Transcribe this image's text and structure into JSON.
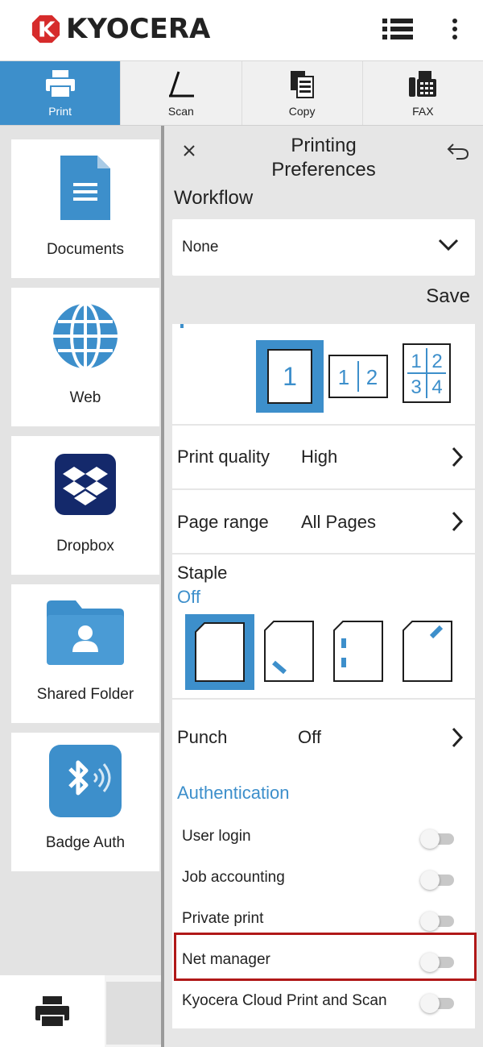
{
  "header": {
    "brand": "KYOCERA",
    "brand_color": "#d62b2b"
  },
  "tabs": [
    {
      "label": "Print",
      "icon": "printer-icon",
      "active": true
    },
    {
      "label": "Scan",
      "icon": "scan-icon",
      "active": false
    },
    {
      "label": "Copy",
      "icon": "copy-icon",
      "active": false
    },
    {
      "label": "FAX",
      "icon": "fax-icon",
      "active": false
    }
  ],
  "sidebar": {
    "items": [
      {
        "label": "Documents",
        "icon": "document-icon"
      },
      {
        "label": "Web",
        "icon": "globe-icon"
      },
      {
        "label": "Dropbox",
        "icon": "dropbox-icon"
      },
      {
        "label": "Shared Folder",
        "icon": "shared-folder-icon"
      },
      {
        "label": "Badge Auth",
        "icon": "badge-bluetooth-icon"
      }
    ]
  },
  "panel": {
    "title_line1": "Printing",
    "title_line2": "Preferences",
    "workflow_label": "Workflow",
    "workflow_value": "None",
    "save_label": "Save",
    "layout_options": [
      "1",
      "1 2",
      "1 2 3 4"
    ],
    "print_quality_label": "Print quality",
    "print_quality_value": "High",
    "page_range_label": "Page range",
    "page_range_value": "All Pages",
    "staple_label": "Staple",
    "staple_value": "Off",
    "punch_label": "Punch",
    "punch_value": "Off",
    "auth_heading": "Authentication",
    "toggles": [
      {
        "label": "User login",
        "on": false
      },
      {
        "label": "Job accounting",
        "on": false
      },
      {
        "label": "Private print",
        "on": false
      },
      {
        "label": "Net manager",
        "on": false
      },
      {
        "label": "Kyocera Cloud Print and Scan",
        "on": false
      }
    ]
  },
  "colors": {
    "accent": "#3d8fcb",
    "highlight": "#b01818"
  }
}
